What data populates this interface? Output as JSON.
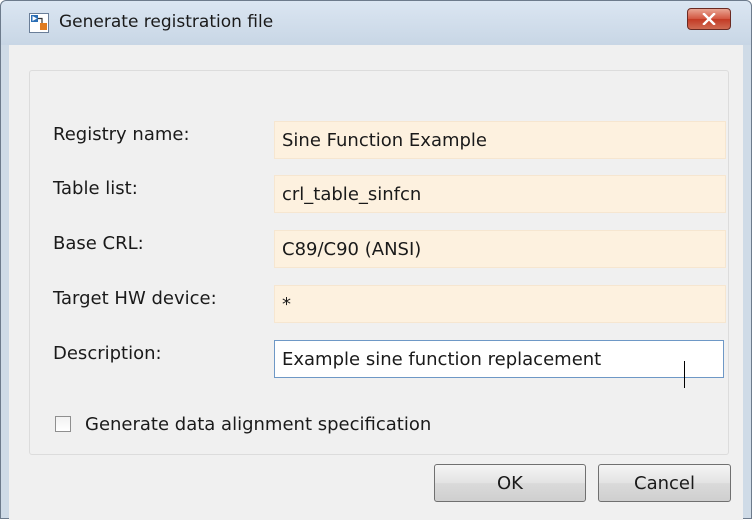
{
  "window": {
    "title": "Generate registration file",
    "close_glyph": "✕"
  },
  "form": {
    "fields": [
      {
        "label": "Registry name:",
        "value": "Sine Function Example"
      },
      {
        "label": "Table list:",
        "value": "crl_table_sinfcn"
      },
      {
        "label": "Base CRL:",
        "value": "C89/C90 (ANSI)"
      },
      {
        "label": "Target HW device:",
        "value": "*"
      },
      {
        "label": "Description:",
        "value": "Example sine function replacement"
      }
    ],
    "checkbox": {
      "label": "Generate data alignment specification",
      "checked": false
    }
  },
  "buttons": {
    "ok_label": "OK",
    "cancel_label": "Cancel"
  },
  "icons": {
    "app": "simulink-model-icon",
    "close": "close-icon"
  },
  "colors": {
    "field_background": "#fdf1df",
    "focused_border": "#6e98c6",
    "close_button": "#c9462f"
  }
}
